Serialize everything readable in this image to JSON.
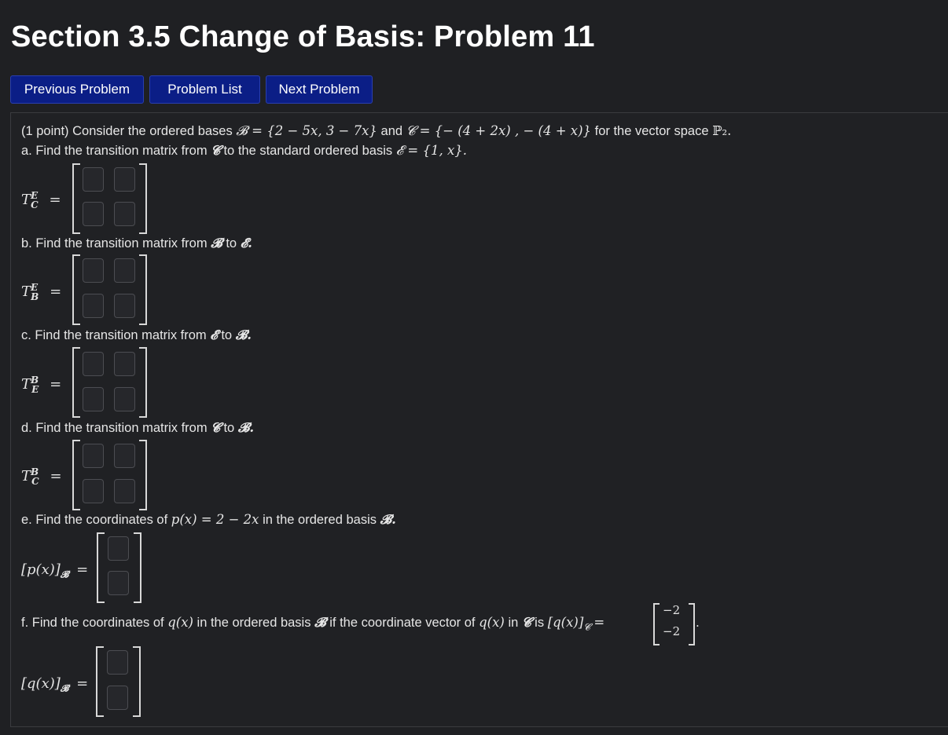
{
  "page_title": "Section 3.5 Change of Basis: Problem 11",
  "nav": {
    "previous": "Previous Problem",
    "list": "Problem List",
    "next": "Next Problem"
  },
  "problem": {
    "intro_points": "(1 point) Consider the ordered bases",
    "basis_B": "𝓑 = {2 − 5x, 3 − 7x}",
    "and": "and",
    "basis_C": "𝓒 = {− (4 + 2x) , − (4 + x)}",
    "for_space": "for the vector space",
    "space": "ℙ₂.",
    "a": {
      "text_before": "a. Find the transition matrix from",
      "from": "𝓒",
      "text_mid": "to the standard ordered basis",
      "to": "𝓔 = {1, x}.",
      "lhs": "T",
      "sup": "E",
      "sub": "C"
    },
    "b": {
      "text": "b. Find the transition matrix from",
      "from": "𝓑",
      "to_word": "to",
      "to": "𝓔.",
      "lhs": "T",
      "sup": "E",
      "sub": "B"
    },
    "c": {
      "text": "c. Find the transition matrix from",
      "from": "𝓔",
      "to_word": "to",
      "to": "𝓑.",
      "lhs": "T",
      "sup": "B",
      "sub": "E"
    },
    "d": {
      "text": "d. Find the transition matrix from",
      "from": "𝓒",
      "to_word": "to",
      "to": "𝓑.",
      "lhs": "T",
      "sup": "B",
      "sub": "C"
    },
    "e": {
      "text": "e. Find the coordinates of",
      "poly": "p(x) = 2 − 2x",
      "text_end": "in the ordered basis",
      "basis": "𝓑.",
      "lhs": "[p(x)]",
      "sub": "𝓑"
    },
    "f": {
      "text": "f. Find the coordinates of",
      "q": "q(x)",
      "text_mid": "in the ordered basis",
      "basis": "𝓑",
      "text_mid2": "if the coordinate vector of",
      "q2": "q(x)",
      "in_word": "in",
      "basisC": "𝓒",
      "is_word": "is",
      "vec_lhs": "[q(x)]",
      "vec_sub": "𝓒",
      "eq": "=",
      "vec_values": [
        "−2",
        "−2"
      ],
      "period": ".",
      "lhs": "[q(x)]",
      "sub": "𝓑"
    },
    "equals": "="
  }
}
